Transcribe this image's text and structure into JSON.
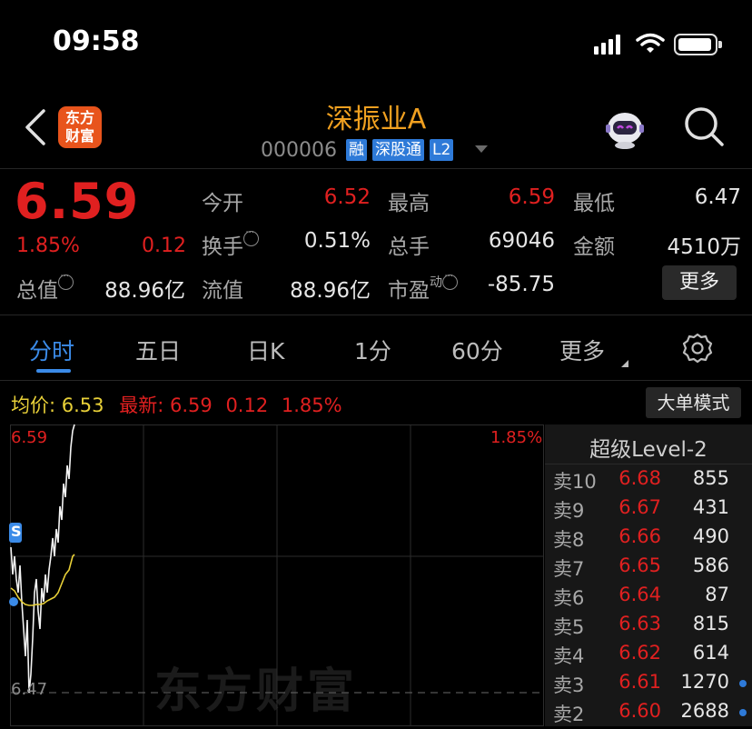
{
  "status_bar": {
    "time": "09:58"
  },
  "header": {
    "logo_line1": "东方",
    "logo_line2": "财富",
    "name": "深振业A",
    "code": "000006",
    "tags": [
      "融",
      "深股通",
      "L2"
    ]
  },
  "quote": {
    "price": "6.59",
    "change_pct": "1.85%",
    "change": "0.12",
    "fields": {
      "open": {
        "label": "今开",
        "value": "6.52"
      },
      "high": {
        "label": "最高",
        "value": "6.59"
      },
      "low": {
        "label": "最低",
        "value": "6.47"
      },
      "turnover": {
        "label": "换手",
        "value": "0.51%"
      },
      "volume": {
        "label": "总手",
        "value": "69046"
      },
      "amount": {
        "label": "金额",
        "value": "4510万"
      },
      "market_cap": {
        "label": "总值",
        "value": "88.96亿"
      },
      "float_cap": {
        "label": "流值",
        "value": "88.96亿"
      },
      "pe": {
        "label": "市盈",
        "superscript": "动",
        "value": "-85.75"
      }
    },
    "more_button": "更多"
  },
  "tabs": [
    "分时",
    "五日",
    "日K",
    "1分",
    "60分",
    "更多"
  ],
  "active_tab": "分时",
  "info_row": {
    "avg_label": "均价:",
    "avg_value": "6.53",
    "last_label": "最新:",
    "last_value": "6.59",
    "last_change": "0.12",
    "last_pct": "1.85%",
    "mode_button": "大单模式"
  },
  "chart_labels": {
    "high": "6.59",
    "low": "6.47",
    "pct": "1.85%",
    "badge": "S",
    "watermark": "东方财富"
  },
  "order_book": {
    "title": "超级Level-2",
    "rows": [
      {
        "label": "卖10",
        "price": "6.68",
        "volume": "855",
        "marker": false
      },
      {
        "label": "卖9",
        "price": "6.67",
        "volume": "431",
        "marker": false
      },
      {
        "label": "卖8",
        "price": "6.66",
        "volume": "490",
        "marker": false
      },
      {
        "label": "卖7",
        "price": "6.65",
        "volume": "586",
        "marker": false
      },
      {
        "label": "卖6",
        "price": "6.64",
        "volume": "87",
        "marker": false
      },
      {
        "label": "卖5",
        "price": "6.63",
        "volume": "815",
        "marker": false
      },
      {
        "label": "卖4",
        "price": "6.62",
        "volume": "614",
        "marker": false
      },
      {
        "label": "卖3",
        "price": "6.61",
        "volume": "1270",
        "marker": true
      },
      {
        "label": "卖2",
        "price": "6.60",
        "volume": "2688",
        "marker": true
      }
    ]
  },
  "colors": {
    "up": "#e02020",
    "accent": "#3b8be8",
    "avg_line": "#e8d038",
    "name": "#f0a020",
    "brand": "#e8541c"
  }
}
